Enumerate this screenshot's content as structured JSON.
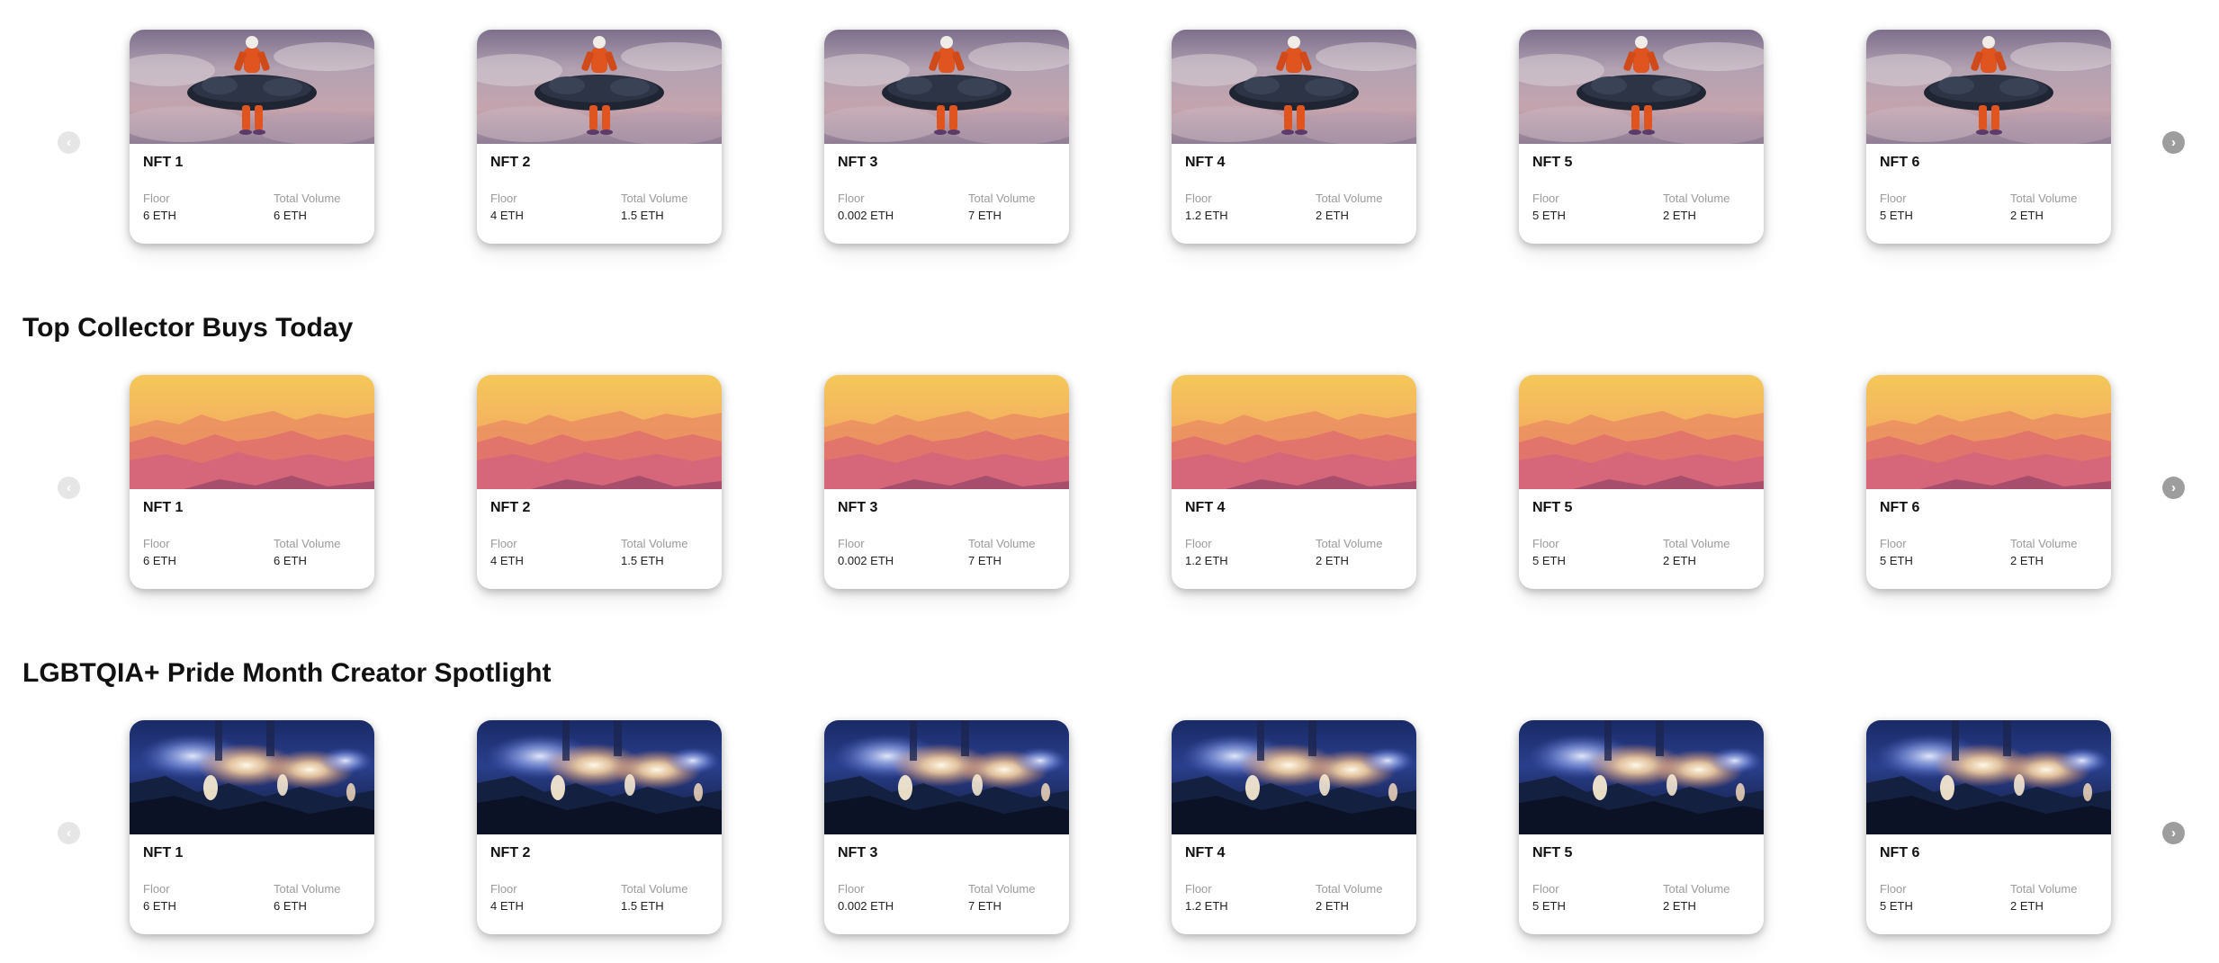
{
  "sections": [
    {
      "title": "",
      "theme": "astronaut",
      "cards": [
        {
          "name": "NFT 1",
          "floor_label": "Floor",
          "floor": "6 ETH",
          "volume_label": "Total Volume",
          "volume": "6 ETH"
        },
        {
          "name": "NFT 2",
          "floor_label": "Floor",
          "floor": "4 ETH",
          "volume_label": "Total Volume",
          "volume": "1.5 ETH"
        },
        {
          "name": "NFT 3",
          "floor_label": "Floor",
          "floor": "0.002 ETH",
          "volume_label": "Total Volume",
          "volume": "7 ETH"
        },
        {
          "name": "NFT 4",
          "floor_label": "Floor",
          "floor": "1.2 ETH",
          "volume_label": "Total Volume",
          "volume": "2 ETH"
        },
        {
          "name": "NFT 5",
          "floor_label": "Floor",
          "floor": "5 ETH",
          "volume_label": "Total Volume",
          "volume": "2 ETH"
        },
        {
          "name": "NFT 6",
          "floor_label": "Floor",
          "floor": "5 ETH",
          "volume_label": "Total Volume",
          "volume": "2 ETH"
        }
      ]
    },
    {
      "title": "Top Collector Buys Today",
      "theme": "sunset-mountains",
      "cards": [
        {
          "name": "NFT 1",
          "floor_label": "Floor",
          "floor": "6 ETH",
          "volume_label": "Total Volume",
          "volume": "6 ETH"
        },
        {
          "name": "NFT 2",
          "floor_label": "Floor",
          "floor": "4 ETH",
          "volume_label": "Total Volume",
          "volume": "1.5 ETH"
        },
        {
          "name": "NFT 3",
          "floor_label": "Floor",
          "floor": "0.002 ETH",
          "volume_label": "Total Volume",
          "volume": "7 ETH"
        },
        {
          "name": "NFT 4",
          "floor_label": "Floor",
          "floor": "1.2 ETH",
          "volume_label": "Total Volume",
          "volume": "2 ETH"
        },
        {
          "name": "NFT 5",
          "floor_label": "Floor",
          "floor": "5 ETH",
          "volume_label": "Total Volume",
          "volume": "2 ETH"
        },
        {
          "name": "NFT 6",
          "floor_label": "Floor",
          "floor": "5 ETH",
          "volume_label": "Total Volume",
          "volume": "2 ETH"
        }
      ]
    },
    {
      "title": "LGBTQIA+ Pride Month Creator Spotlight",
      "theme": "night-lights",
      "cards": [
        {
          "name": "NFT 1",
          "floor_label": "Floor",
          "floor": "6 ETH",
          "volume_label": "Total Volume",
          "volume": "6 ETH"
        },
        {
          "name": "NFT 2",
          "floor_label": "Floor",
          "floor": "4 ETH",
          "volume_label": "Total Volume",
          "volume": "1.5 ETH"
        },
        {
          "name": "NFT 3",
          "floor_label": "Floor",
          "floor": "0.002 ETH",
          "volume_label": "Total Volume",
          "volume": "7 ETH"
        },
        {
          "name": "NFT 4",
          "floor_label": "Floor",
          "floor": "1.2 ETH",
          "volume_label": "Total Volume",
          "volume": "2 ETH"
        },
        {
          "name": "NFT 5",
          "floor_label": "Floor",
          "floor": "5 ETH",
          "volume_label": "Total Volume",
          "volume": "2 ETH"
        },
        {
          "name": "NFT 6",
          "floor_label": "Floor",
          "floor": "5 ETH",
          "volume_label": "Total Volume",
          "volume": "2 ETH"
        }
      ]
    }
  ],
  "carousel": {
    "prev_icon": "chevron-left-icon",
    "next_icon": "chevron-right-icon",
    "prev_glyph": "‹",
    "next_glyph": "›",
    "prev_color": "#e6e6e6",
    "next_color": "#9d9d9d"
  }
}
